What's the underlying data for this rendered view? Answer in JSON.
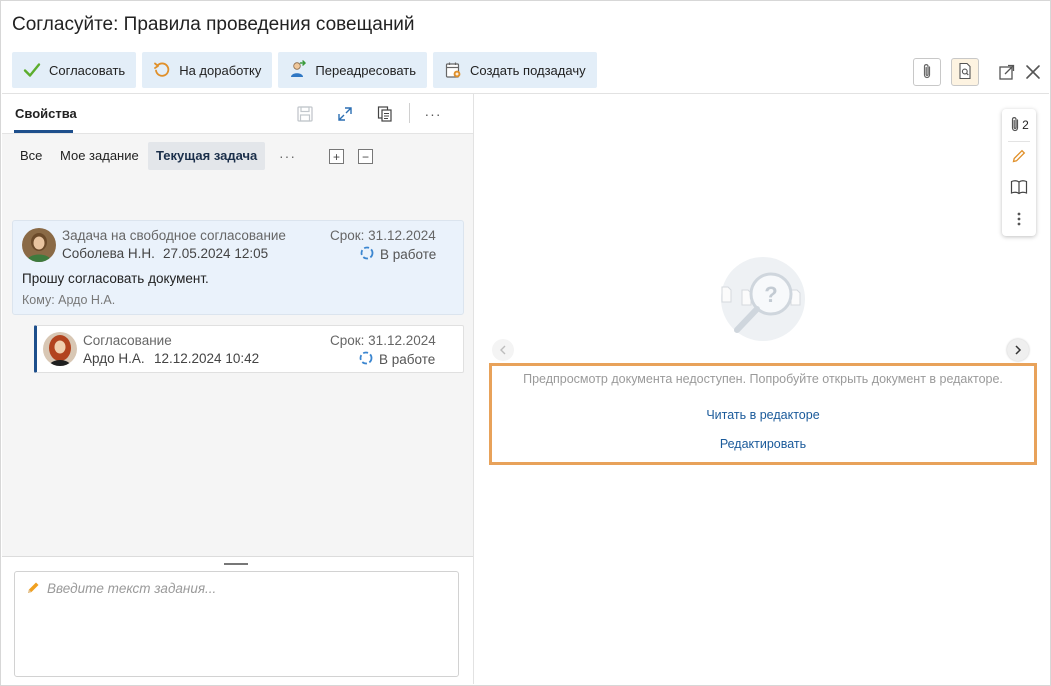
{
  "window": {
    "title": "Согласуйте: Правила проведения совещаний"
  },
  "toolbar": {
    "approve": "Согласовать",
    "rework": "На доработку",
    "redirect": "Переадресовать",
    "subtask": "Создать подзадачу"
  },
  "left_panel": {
    "tab_label": "Свойства",
    "filters": [
      "Все",
      "Мое задание",
      "Текущая задача"
    ],
    "more": "···",
    "expand_all": "+",
    "collapse_all": "−"
  },
  "tasks": [
    {
      "title": "Задача на свободное согласование",
      "author": "Соболева Н.Н.",
      "date": "27.05.2024 12:05",
      "deadline": "Срок: 31.12.2024",
      "status": "В работе",
      "message": "Прошу согласовать документ.",
      "recipient": "Кому: Ардо Н.А."
    },
    {
      "title": "Согласование",
      "author": "Ардо Н.А.",
      "date": "12.12.2024 10:42",
      "deadline": "Срок: 31.12.2024",
      "status": "В работе"
    }
  ],
  "task_input": {
    "placeholder": "Введите текст задания..."
  },
  "preview": {
    "attachments_count": "2",
    "message": "Предпросмотр документа недоступен. Попробуйте открыть документ в редакторе.",
    "read_link": "Читать в редакторе",
    "edit_link": "Редактировать"
  },
  "colors": {
    "accent": "#1e4f8c",
    "button_bg": "#e3eef8",
    "highlight_border": "#e8a25a",
    "link": "#1a5a9a"
  }
}
